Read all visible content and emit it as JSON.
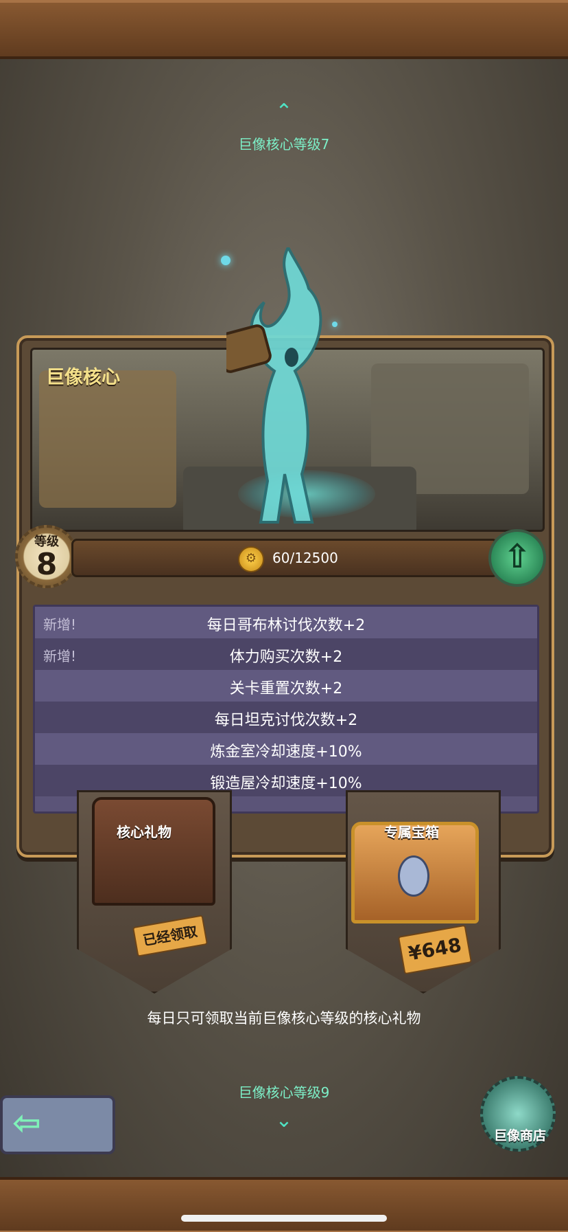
{
  "nav": {
    "prev_label": "巨像核心等级7",
    "next_label": "巨像核心等级9"
  },
  "core": {
    "title": "巨像核心",
    "level_label": "等级",
    "level_value": "8",
    "exp_text": "60/12500"
  },
  "bonuses": [
    {
      "new": "新增!",
      "text": "每日哥布林讨伐次数+2"
    },
    {
      "new": "新增!",
      "text": "体力购买次数+2"
    },
    {
      "new": "",
      "text": "关卡重置次数+2"
    },
    {
      "new": "",
      "text": "每日坦克讨伐次数+2"
    },
    {
      "new": "",
      "text": "炼金室冷却速度+10%"
    },
    {
      "new": "",
      "text": "锻造屋冷却速度+10%"
    }
  ],
  "chests": {
    "gift_label": "核心礼物",
    "gift_status": "已经领取",
    "exclusive_label": "专属宝箱",
    "exclusive_price": "¥648"
  },
  "note": "每日只可领取当前巨像核心等级的核心礼物",
  "shop": {
    "label": "巨像商店"
  },
  "icons": [
    "chevron-up-icon",
    "chevron-down-icon",
    "coin-gear-icon",
    "upgrade-arrow-icon",
    "back-arrow-icon",
    "spirit-shop-icon",
    "lock-icon"
  ],
  "colors": {
    "accent": "#7df0c8",
    "panel_purple": "#5b5478",
    "wood": "#8a5a32",
    "gold": "#f4e08a"
  }
}
